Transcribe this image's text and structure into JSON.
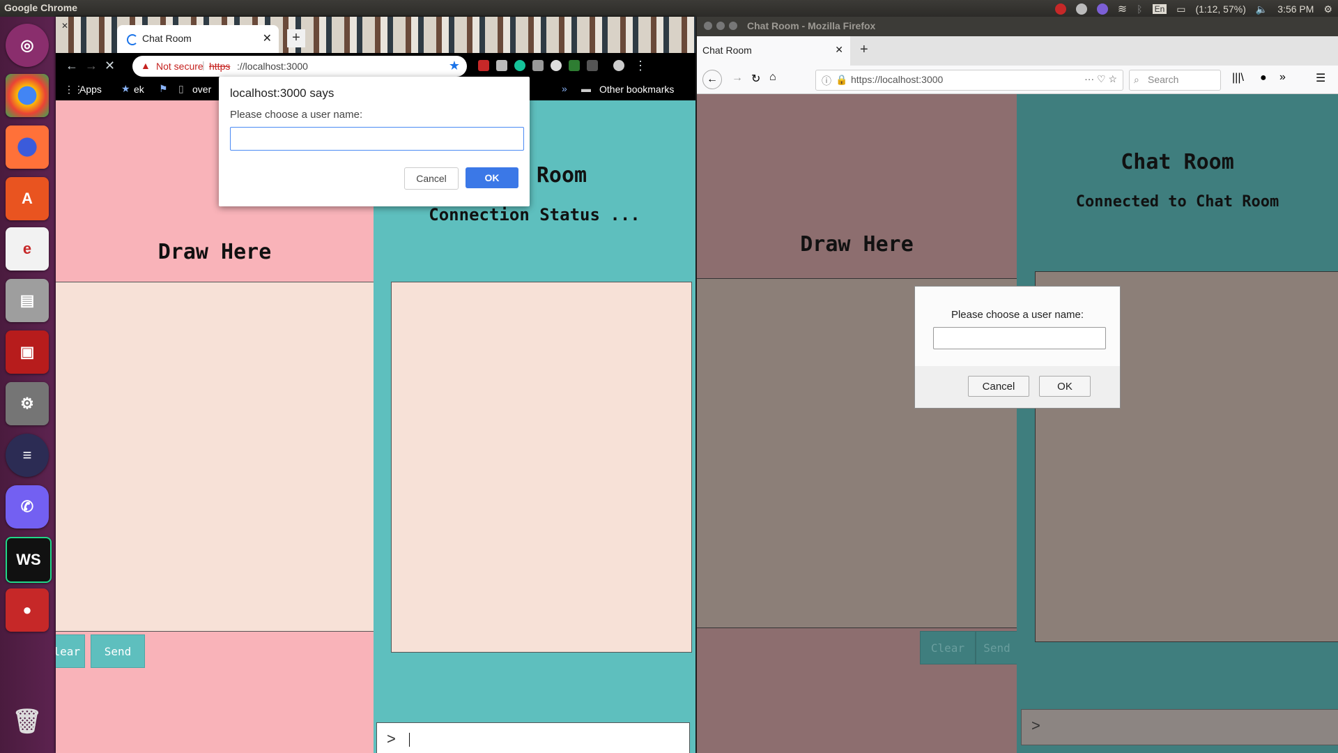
{
  "topbar": {
    "app_name": "Google Chrome",
    "battery": "(1:12, 57%)",
    "time": "3:56 PM",
    "lang": "En"
  },
  "launcher": {
    "items": [
      "ubuntu-icon",
      "chrome-icon",
      "firefox-icon",
      "software-center-icon",
      "ebook-icon",
      "files-icon",
      "terminal-icon",
      "settings-icon",
      "eclipse-icon",
      "viber-icon",
      "webstorm-icon",
      "recorder-icon",
      "trash-icon"
    ],
    "webstorm_label": "WS"
  },
  "chrome": {
    "tab_title": "Chat Room",
    "omnibox": {
      "security_label": "Not secure",
      "scheme": "https",
      "host_rest": "://localhost:3000"
    },
    "bookmarks": {
      "apps": "Apps",
      "ek": "ek",
      "over": "over",
      "overflow": "»",
      "other": "Other bookmarks"
    },
    "page": {
      "draw_title": "Draw Here",
      "chat_title": "Room",
      "status": "Connection Status ...",
      "clear_btn": "Clear",
      "send_btn": "Send",
      "prompt_symbol": ">"
    },
    "alert": {
      "title": "localhost:3000 says",
      "message": "Please choose a user name:",
      "value": "",
      "cancel": "Cancel",
      "ok": "OK"
    }
  },
  "firefox": {
    "window_title": "Chat Room - Mozilla Firefox",
    "tab_title": "Chat Room",
    "url": "https://localhost:3000",
    "search_placeholder": "Search",
    "page": {
      "draw_title": "Draw Here",
      "chat_title": "Chat Room",
      "status": "Connected to Chat Room",
      "clear_btn": "Clear",
      "send_btn": "Send",
      "prompt_symbol": ">"
    },
    "alert": {
      "message": "Please choose a user name:",
      "cancel": "Cancel",
      "ok": "OK"
    }
  }
}
